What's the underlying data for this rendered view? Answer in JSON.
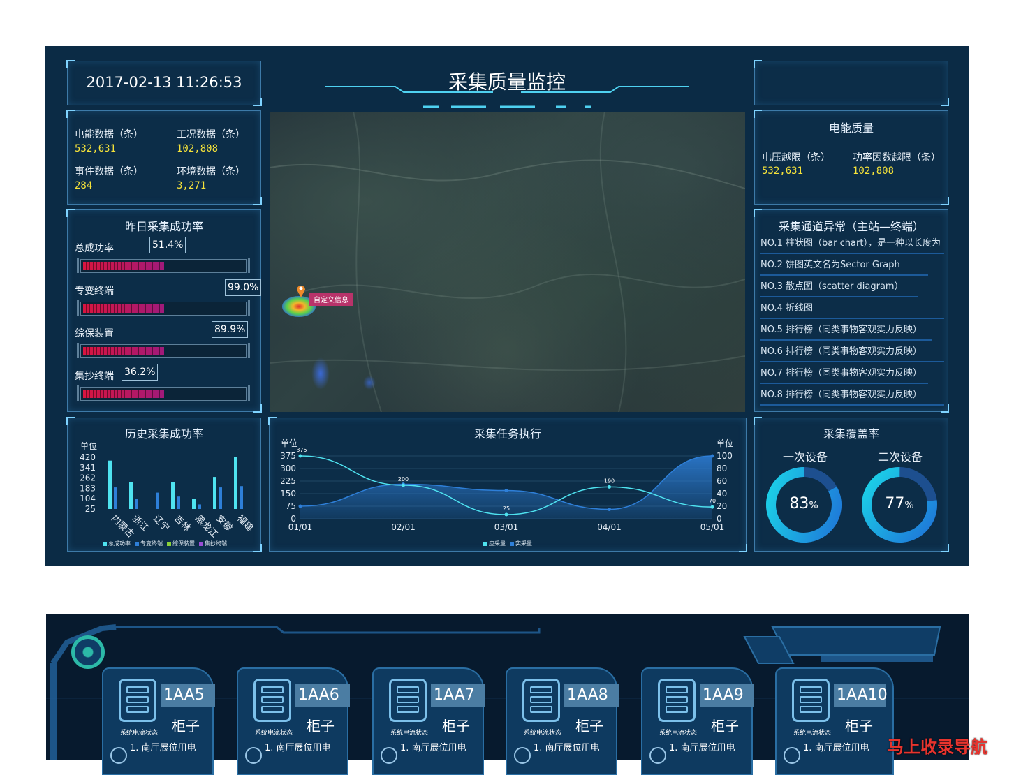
{
  "header": {
    "datetime": "2017-02-13 11:26:53",
    "title": "采集质量监控"
  },
  "counts": [
    {
      "label": "电能数据（条）",
      "value": "532,631"
    },
    {
      "label": "工况数据（条）",
      "value": "102,808"
    },
    {
      "label": "事件数据（条）",
      "value": "284"
    },
    {
      "label": "环境数据（条）",
      "value": "3,271"
    }
  ],
  "yesterday": {
    "title": "昨日采集成功率",
    "rows": [
      {
        "label": "总成功率",
        "percent": "51.4%"
      },
      {
        "label": "专变终端",
        "percent": "99.0%"
      },
      {
        "label": "综保装置",
        "percent": "89.9%"
      },
      {
        "label": "集抄终端",
        "percent": "36.2%"
      }
    ]
  },
  "power_quality": {
    "title": "电能质量",
    "items": [
      {
        "label": "电压越限（条）",
        "value": "532,631"
      },
      {
        "label": "功率因数越限（条）",
        "value": "102,808"
      }
    ]
  },
  "channel_alarm": {
    "title": "采集通道异常（主站—终端）",
    "items": [
      "NO.1  柱状图（bar chart），是一种以长度为",
      "NO.2  饼图英文名为Sector Graph",
      "NO.3  散点图（scatter diagram）",
      "NO.4  折线图",
      "NO.5  排行榜（同类事物客观实力反映）",
      "NO.6  排行榜（同类事物客观实力反映）",
      "NO.7  排行榜（同类事物客观实力反映）",
      "NO.8  排行榜（同类事物客观实力反映）"
    ]
  },
  "map": {
    "marker_label": "自定义信息"
  },
  "coverage": {
    "title": "采集覆盖率",
    "items": [
      {
        "label": "一次设备",
        "value": "83",
        "unit": "%",
        "fraction": 0.83
      },
      {
        "label": "二次设备",
        "value": "77",
        "unit": "%",
        "fraction": 0.77
      }
    ]
  },
  "chart_data": [
    {
      "type": "bar",
      "title": "历史采集成功率",
      "ylabel": "单位",
      "yticks": [
        "420",
        "341",
        "262",
        "183",
        "104",
        "25"
      ],
      "ylim": [
        25,
        420
      ],
      "categories": [
        "内蒙古",
        "浙江",
        "辽宁",
        "吉林",
        "黑龙江",
        "安徽",
        "福建"
      ],
      "series": [
        {
          "name": "总成功率",
          "color": "#4fe3f0",
          "values": [
            395,
            230,
            25,
            230,
            104,
            270,
            420
          ]
        },
        {
          "name": "专变终端",
          "color": "#2e7fd8",
          "values": [
            190,
            104,
            150,
            120,
            60,
            190,
            200
          ]
        },
        {
          "name": "综保装置",
          "color": "#8ad13a",
          "values": [
            0,
            0,
            0,
            0,
            0,
            0,
            0
          ]
        },
        {
          "name": "集抄终端",
          "color": "#9b4dd6",
          "values": [
            0,
            0,
            0,
            0,
            0,
            0,
            0
          ]
        }
      ]
    },
    {
      "type": "line",
      "title": "采集任务执行",
      "ylabel_left": "单位",
      "ylabel_right": "单位",
      "yticks_left": [
        "375",
        "300",
        "225",
        "150",
        "75",
        "0"
      ],
      "yticks_right": [
        "100",
        "80",
        "60",
        "40",
        "20",
        "0"
      ],
      "ylim_left": [
        0,
        375
      ],
      "ylim_right": [
        0,
        100
      ],
      "x": [
        "01/01",
        "02/01",
        "03/01",
        "04/01",
        "05/01"
      ],
      "series": [
        {
          "name": "应采量",
          "color": "#4fe3f0",
          "axis": "left",
          "values": [
            375,
            200,
            25,
            190,
            70
          ],
          "labels": [
            "375",
            "200",
            "25",
            "190",
            "70"
          ]
        },
        {
          "name": "实采量",
          "color": "#2e7fd8",
          "axis": "right",
          "values": [
            20,
            55,
            45,
            15,
            100
          ]
        }
      ]
    }
  ],
  "cabinets": [
    {
      "code": "1AA5",
      "type": "柜子",
      "status": "系统电流状态",
      "item": "1. 南厅展位用电"
    },
    {
      "code": "1AA6",
      "type": "柜子",
      "status": "系统电流状态",
      "item": "1. 南厅展位用电"
    },
    {
      "code": "1AA7",
      "type": "柜子",
      "status": "系统电流状态",
      "item": "1. 南厅展位用电"
    },
    {
      "code": "1AA8",
      "type": "柜子",
      "status": "系统电流状态",
      "item": "1. 南厅展位用电"
    },
    {
      "code": "1AA9",
      "type": "柜子",
      "status": "系统电流状态",
      "item": "1. 南厅展位用电"
    },
    {
      "code": "1AA10",
      "type": "柜子",
      "status": "系统电流状态",
      "item": "1. 南厅展位用电"
    }
  ],
  "watermark": "马上收录导航",
  "colors": {
    "background": "#0b2b45",
    "accent": "#4fe3f0",
    "value": "#f5e23a",
    "bar": "#d1164d"
  }
}
